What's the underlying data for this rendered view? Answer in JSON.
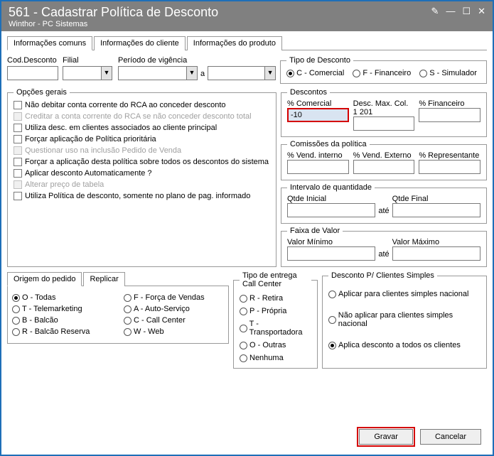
{
  "window": {
    "title": "561 - Cadastrar Política de Desconto",
    "subtitle": "Winthor - PC Sistemas",
    "btn_edit": "✎",
    "btn_min": "—",
    "btn_max": "☐",
    "btn_close": "✕"
  },
  "tabs": {
    "t1": "Informações comuns",
    "t2": "Informações do cliente",
    "t3": "Informações do produto"
  },
  "row1": {
    "cod_label": "Cod.Desconto",
    "cod_value": "",
    "filial_label": "Filial",
    "filial_value": "",
    "periodo_label": "Período de vigência",
    "periodo_a": "a",
    "periodo_start": "",
    "periodo_end": ""
  },
  "tipo_desconto": {
    "legend": "Tipo de Desconto",
    "c": "C - Comercial",
    "f": "F - Financeiro",
    "s": "S - Simulador"
  },
  "opcoes": {
    "legend": "Opções gerais",
    "o1": "Não debitar conta corrente do RCA ao conceder desconto",
    "o2": "Creditar a conta corrente do RCA se não conceder desconto total",
    "o3": "Utiliza desc. em clientes associados ao cliente principal",
    "o4": "Forçar aplicação de Política prioritária",
    "o5": "Questionar uso na inclusão Pedido de Venda",
    "o6": "Forçar a aplicação desta política sobre todos os descontos do sistema",
    "o7": "Aplicar desconto Automaticamente ?",
    "o8": "Alterar preço de tabela",
    "o9": "Utiliza Política de desconto, somente no plano de pag. informado"
  },
  "descontos": {
    "legend": "Descontos",
    "pcom_label": "% Comercial",
    "pcom_value": "-10",
    "dmax_label": "Desc. Max. Col. 1 201",
    "dmax_value": "",
    "pfin_label": "% Financeiro",
    "pfin_value": ""
  },
  "comissoes": {
    "legend": "Comissões da política",
    "vi_label": "% Vend. interno",
    "vi_value": "",
    "ve_label": "% Vend. Externo",
    "ve_value": "",
    "rep_label": "% Representante",
    "rep_value": ""
  },
  "intervalo": {
    "legend": "Intervalo de quantidade",
    "qi_label": "Qtde Inicial",
    "qi_value": "",
    "ate": "até",
    "qf_label": "Qtde Final",
    "qf_value": ""
  },
  "faixa": {
    "legend": "Faixa de Valor",
    "vmin_label": "Valor Mínimo",
    "vmin_value": "",
    "ate": "até",
    "vmax_label": "Valor Máximo",
    "vmax_value": ""
  },
  "origem": {
    "tab1": "Origem do pedido",
    "tab2": "Replicar",
    "o": "O - Todas",
    "t": "T - Telemarketing",
    "b": "B - Balcão",
    "r": "R - Balcão Reserva",
    "f": "F - Força de Vendas",
    "a": "A - Auto-Serviço",
    "c": "C - Call Center",
    "w": "W - Web"
  },
  "entrega": {
    "legend": "Tipo de entrega Call Center",
    "r": "R - Retira",
    "p": "P - Própria",
    "t": "T - Transportadora",
    "o": "O - Outras",
    "n": "Nenhuma"
  },
  "simples": {
    "legend": "Desconto P/ Clientes Simples",
    "o1": "Aplicar para clientes simples nacional",
    "o2": "Não aplicar para clientes simples nacional",
    "o3": "Aplica desconto a todos os clientes"
  },
  "buttons": {
    "gravar": "Gravar",
    "cancelar": "Cancelar"
  }
}
